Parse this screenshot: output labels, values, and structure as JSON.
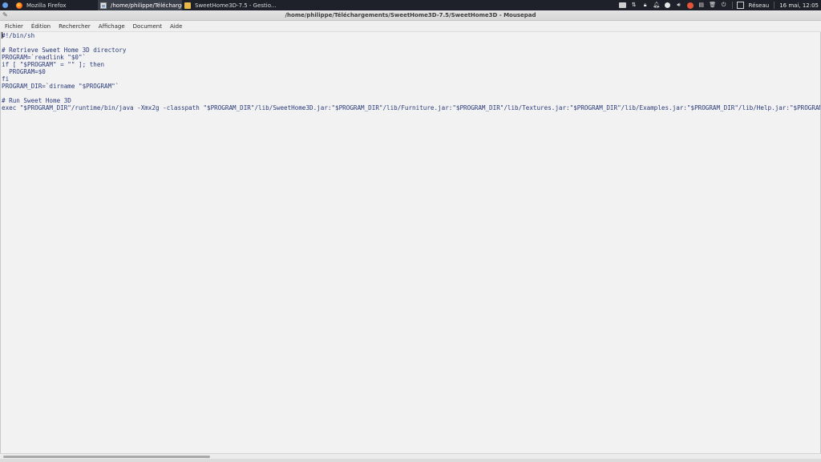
{
  "panel": {
    "tasks": [
      {
        "label": "Mozilla Firefox",
        "icon": "firefox-icon",
        "active": false
      },
      {
        "label": "/home/philippe/Télécharge...",
        "icon": "text-editor-icon",
        "active": true
      },
      {
        "label": "SweetHome3D-7.5 - Gestio...",
        "icon": "folder-icon",
        "active": false
      }
    ],
    "tray": {
      "network_label": "Réseau",
      "clock": "16 mai, 12:05"
    }
  },
  "window": {
    "title": "/home/philippe/Téléchargements/SweetHome3D-7.5/SweetHome3D - Mousepad"
  },
  "menubar": {
    "items": [
      "Fichier",
      "Édition",
      "Rechercher",
      "Affichage",
      "Document",
      "Aide"
    ]
  },
  "editor": {
    "lines": [
      "#!/bin/sh",
      "",
      "# Retrieve Sweet Home 3D directory",
      "PROGRAM=`readlink \"$0\"`",
      "if [ \"$PROGRAM\" = \"\" ]; then",
      "  PROGRAM=$0",
      "fi",
      "PROGRAM_DIR=`dirname \"$PROGRAM\"`",
      "",
      "# Run Sweet Home 3D",
      "exec \"$PROGRAM_DIR\"/runtime/bin/java -Xmx2g -classpath \"$PROGRAM_DIR\"/lib/SweetHome3D.jar:\"$PROGRAM_DIR\"/lib/Furniture.jar:\"$PROGRAM_DIR\"/lib/Textures.jar:\"$PROGRAM_DIR\"/lib/Examples.jar:\"$PROGRAM_DIR\"/lib/Help.jar:\"$PROGRAM_DIR\"/lib/batik-"
    ]
  },
  "colors": {
    "panel_bg": "#1e2129",
    "code_text": "#2b3b7a",
    "editor_bg": "#f2f2f2"
  }
}
